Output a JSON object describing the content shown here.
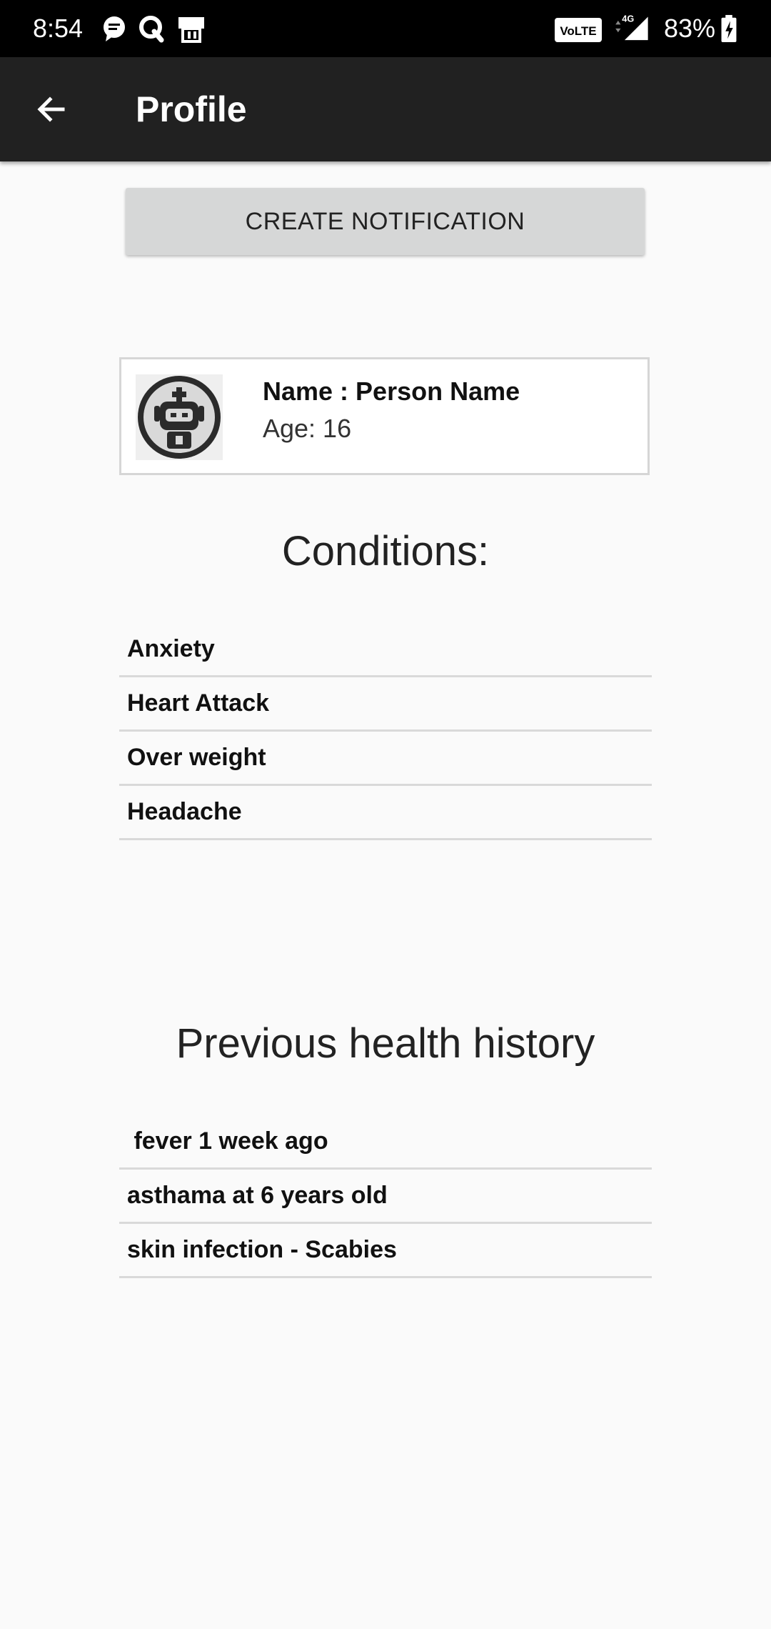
{
  "status_bar": {
    "time": "8:54",
    "battery": "83%",
    "icons": [
      "chat-icon",
      "q-app-icon",
      "phone-clean-icon",
      "volte-icon",
      "signal-4g-icon",
      "battery-charging-icon"
    ],
    "volte_label": "VoLTE",
    "network_label": "4G"
  },
  "app_bar": {
    "back_icon": "arrow-back-icon",
    "title": "Profile"
  },
  "actions": {
    "create_notification_label": "CREATE NOTIFICATION"
  },
  "profile": {
    "avatar_icon": "robot-medic-avatar",
    "name_line": "Name : Person Name",
    "age_line": "Age: 16"
  },
  "conditions": {
    "title": "Conditions:",
    "items": [
      "Anxiety",
      "Heart Attack",
      "Over weight",
      "Headache"
    ]
  },
  "history": {
    "title": "Previous health history",
    "items": [
      " fever 1 week ago",
      "asthama at 6 years old",
      "skin infection - Scabies"
    ]
  },
  "colors": {
    "status_bar_bg": "#000000",
    "app_bar_bg": "#212121",
    "page_bg": "#fafafa",
    "button_bg": "#d6d7d7",
    "divider": "#d9d9d9"
  }
}
